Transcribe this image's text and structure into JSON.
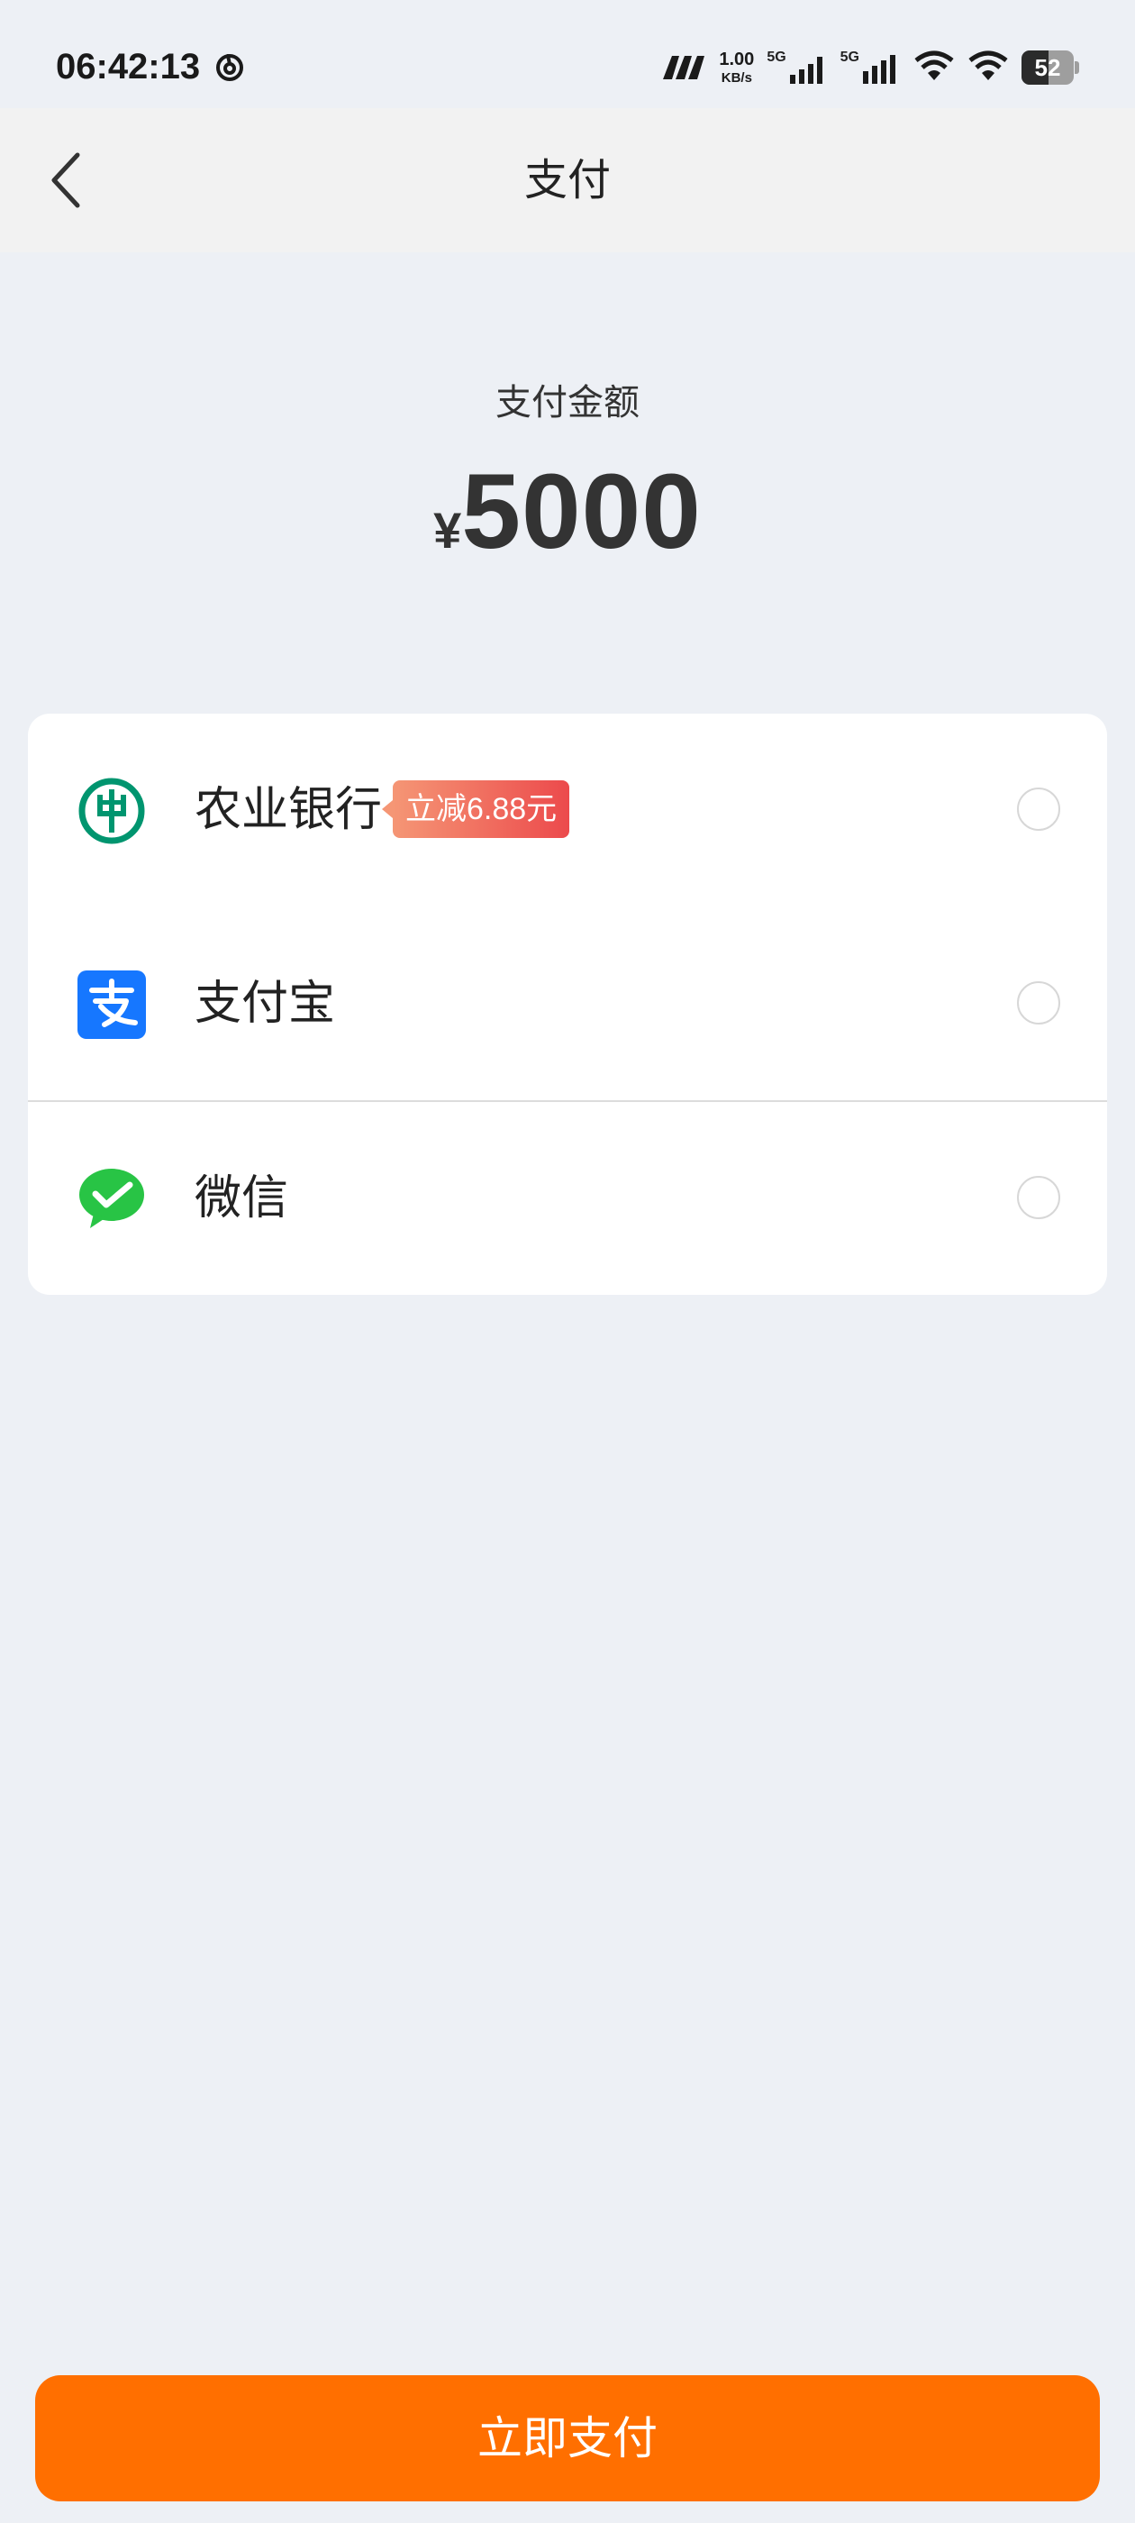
{
  "status_bar": {
    "time": "06:42:13",
    "net_speed_value": "1.00",
    "net_speed_unit": "KB/s",
    "sim1_label": "5G",
    "sim2_label": "5G",
    "battery_level": "52"
  },
  "nav": {
    "title": "支付"
  },
  "payment": {
    "amount_label": "支付金额",
    "currency": "¥",
    "amount": "5000"
  },
  "methods": [
    {
      "name": "农业银行",
      "promo": "立减6.88元",
      "selected": false
    },
    {
      "name": "支付宝",
      "selected": false
    },
    {
      "name": "微信",
      "selected": false
    }
  ],
  "colors": {
    "primary": "#ff6f00",
    "abc_green": "#00956f",
    "alipay_blue": "#1677ff",
    "wechat_green": "#28c445",
    "promo_start": "#f59675",
    "promo_end": "#ec4a4c"
  },
  "actions": {
    "pay_now": "立即支付"
  }
}
